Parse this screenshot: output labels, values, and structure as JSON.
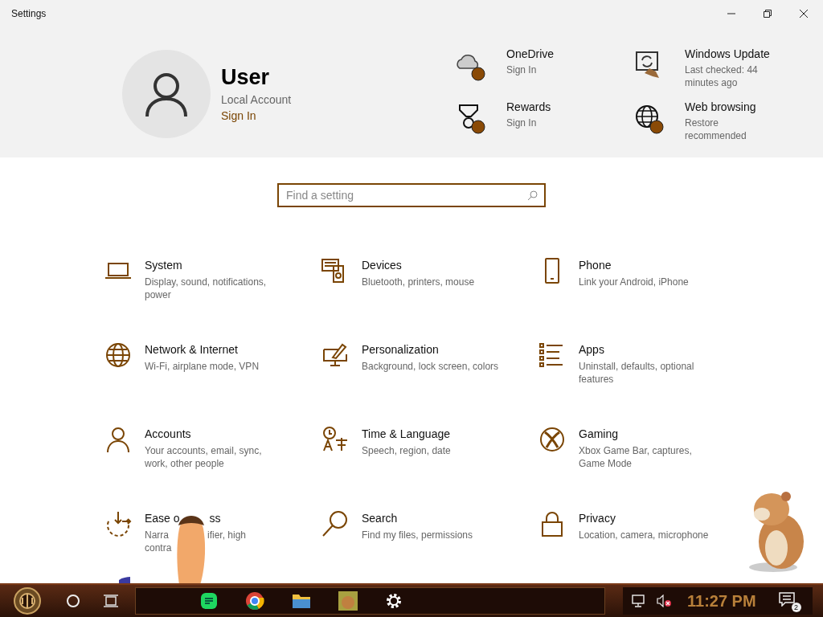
{
  "window": {
    "title": "Settings"
  },
  "profile": {
    "name": "User",
    "account": "Local Account",
    "link": "Sign In"
  },
  "services": [
    {
      "kind": "cloud",
      "title": "OneDrive",
      "subtitle": "Sign In",
      "alert": true
    },
    {
      "kind": "update",
      "title": "Windows Update",
      "subtitle": "Last checked: 44 minutes ago",
      "alert": false
    },
    {
      "kind": "medal",
      "title": "Rewards",
      "subtitle": "Sign In",
      "alert": true
    },
    {
      "kind": "globe",
      "title": "Web browsing",
      "subtitle": "Restore recommended",
      "alert": true
    }
  ],
  "search": {
    "placeholder": "Find a setting"
  },
  "categories": [
    {
      "kind": "laptop",
      "title": "System",
      "description": "Display, sound, notifications, power"
    },
    {
      "kind": "devices",
      "title": "Devices",
      "description": "Bluetooth, printers, mouse"
    },
    {
      "kind": "phone",
      "title": "Phone",
      "description": "Link your Android, iPhone"
    },
    {
      "kind": "globe",
      "title": "Network & Internet",
      "description": "Wi-Fi, airplane mode, VPN"
    },
    {
      "kind": "paint",
      "title": "Personalization",
      "description": "Background, lock screen, colors"
    },
    {
      "kind": "apps",
      "title": "Apps",
      "description": "Uninstall, defaults, optional features"
    },
    {
      "kind": "person",
      "title": "Accounts",
      "description": "Your accounts, email, sync, work, other people"
    },
    {
      "kind": "language",
      "title": "Time & Language",
      "description": "Speech, region, date"
    },
    {
      "kind": "xbox",
      "title": "Gaming",
      "description": "Xbox Game Bar, captures, Game Mode"
    },
    {
      "kind": "ease",
      "title": "Ease o",
      "title_tail": "ss",
      "description": "Narra",
      "description_tail": "ifier, high",
      "description_line2": "contra"
    },
    {
      "kind": "search",
      "title": "Search",
      "description": "Find my files, permissions"
    },
    {
      "kind": "lock",
      "title": "Privacy",
      "description": "Location, camera, microphone"
    }
  ],
  "taskbar": {
    "time": "11:27 PM",
    "notifications": "2"
  }
}
